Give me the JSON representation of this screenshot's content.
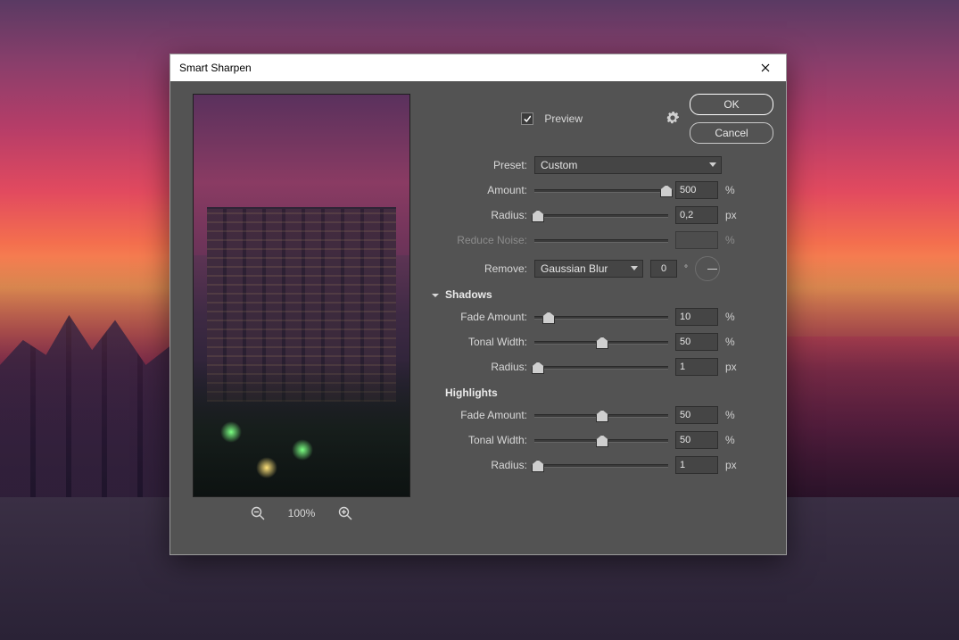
{
  "dialog": {
    "title": "Smart Sharpen",
    "preview_label": "Preview",
    "preview_checked": true,
    "ok_label": "OK",
    "cancel_label": "Cancel",
    "zoom_level": "100%"
  },
  "preset": {
    "label": "Preset:",
    "value": "Custom"
  },
  "main": {
    "amount": {
      "label": "Amount:",
      "value": "500",
      "unit": "%",
      "pct": 98
    },
    "radius": {
      "label": "Radius:",
      "value": "0,2",
      "unit": "px",
      "pct": 2
    },
    "reduce_noise": {
      "label": "Reduce Noise:",
      "value": "",
      "unit": "%",
      "pct": 0,
      "disabled": true
    },
    "remove": {
      "label": "Remove:",
      "value": "Gaussian Blur",
      "angle": "0"
    }
  },
  "shadows": {
    "heading": "Shadows",
    "fade_amount": {
      "label": "Fade Amount:",
      "value": "10",
      "unit": "%",
      "pct": 10
    },
    "tonal_width": {
      "label": "Tonal Width:",
      "value": "50",
      "unit": "%",
      "pct": 50
    },
    "radius": {
      "label": "Radius:",
      "value": "1",
      "unit": "px",
      "pct": 2
    }
  },
  "highlights": {
    "heading": "Highlights",
    "fade_amount": {
      "label": "Fade Amount:",
      "value": "50",
      "unit": "%",
      "pct": 50
    },
    "tonal_width": {
      "label": "Tonal Width:",
      "value": "50",
      "unit": "%",
      "pct": 50
    },
    "radius": {
      "label": "Radius:",
      "value": "1",
      "unit": "px",
      "pct": 2
    }
  }
}
